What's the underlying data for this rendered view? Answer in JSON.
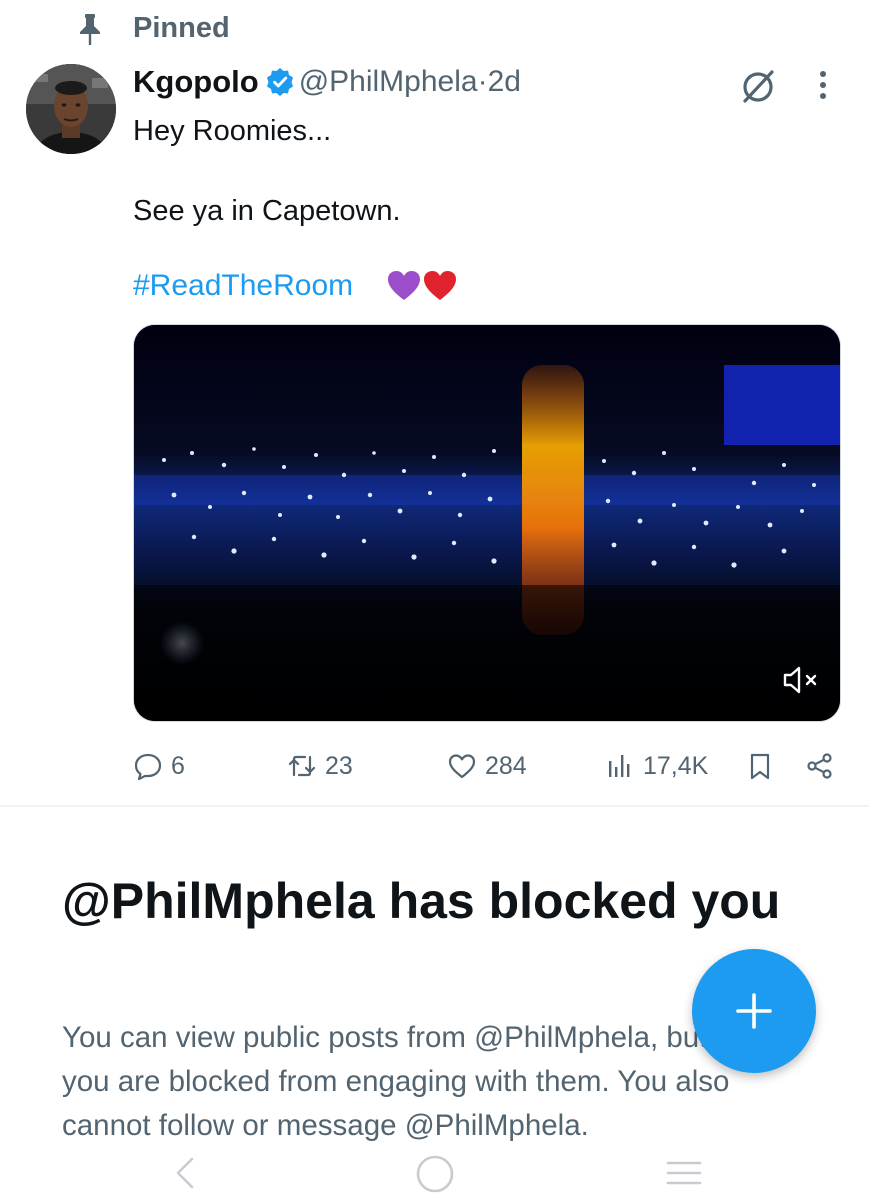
{
  "pinned": {
    "label": "Pinned",
    "icon": "pin-icon"
  },
  "tweet": {
    "display_name": "Kgopolo",
    "handle": "@PhilMphela",
    "separator": "·",
    "time": "2d",
    "text_line1": "Hey Roomies...",
    "text_line2": "See ya in Capetown.",
    "hashtag": "#ReadTheRoom",
    "emojis": [
      "purple-heart",
      "red-heart"
    ],
    "stats": {
      "replies": "6",
      "reposts": "23",
      "likes": "284",
      "views": "17,4K"
    }
  },
  "blocked": {
    "title": "@PhilMphela has blocked you",
    "description": "You can view public posts from @PhilMphela, but you are blocked from engaging with them. You also cannot follow or message @PhilMphela."
  },
  "colors": {
    "accent": "#1d9bf0",
    "secondary_text": "#536471",
    "primary_text": "#0f1419"
  }
}
